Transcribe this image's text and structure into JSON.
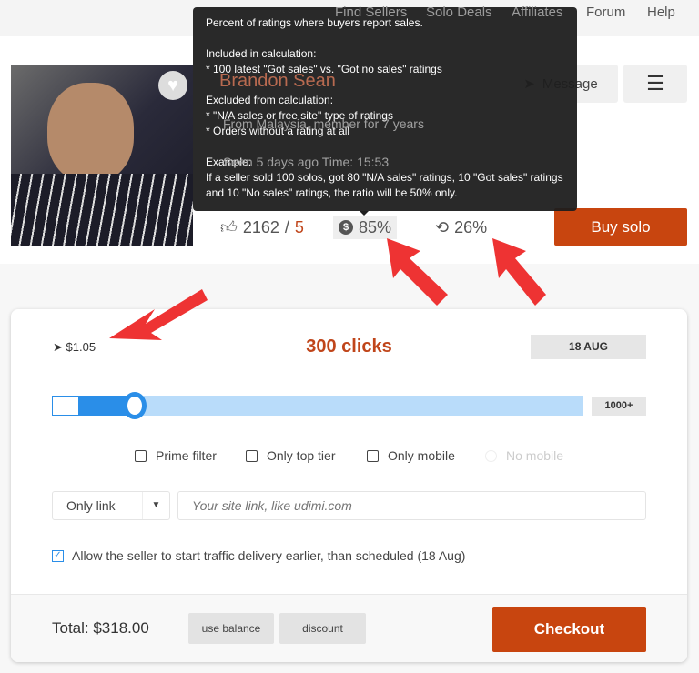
{
  "nav": {
    "items": [
      "Find Sellers",
      "Solo Deals",
      "Affiliates",
      "Forum",
      "Help"
    ]
  },
  "profile": {
    "name": "Brandon Sean",
    "location": "From Malaysia, member for 7 years",
    "seen": "Seen 5 days ago   Time: 15:53",
    "message_label": "Message",
    "menu_icon": "hamburger-icon",
    "favorite_icon": "heart-icon"
  },
  "stats": {
    "likes": "2162",
    "separator": "/",
    "dislikes": "5",
    "sales_ratio": "85%",
    "repeat": "26%",
    "buy_label": "Buy solo"
  },
  "tooltip": {
    "text": "Percent of ratings where buyers report sales.\n\nIncluded in calculation:\n* 100 latest \"Got sales\" vs. \"Got no sales\" ratings\n\nExcluded from calculation:\n* \"N/A sales or free site\" type of ratings\n* Orders without a rating at all\n\nExample:\nIf a seller sold 100 solos, got 80 \"N/A sales\" ratings, 10 \"Got sales\" ratings and 10 \"No sales\" ratings, the ratio will be 50% only."
  },
  "order": {
    "price": "$1.05",
    "clicks": "300 clicks",
    "date": "18 AUG",
    "slider_max": "1000+",
    "slider_value": 300,
    "filters": [
      {
        "label": "Prime filter",
        "checked": false
      },
      {
        "label": "Only top tier",
        "checked": false
      },
      {
        "label": "Only mobile",
        "checked": false
      },
      {
        "label": "No mobile",
        "disabled": true
      }
    ],
    "link_type": "Only link",
    "link_placeholder": "Your site link, like udimi.com",
    "allow_early": "Allow the seller to start traffic delivery earlier, than scheduled (18 Aug)",
    "allow_checked": true
  },
  "footer": {
    "total": "Total: $318.00",
    "use_balance": "use balance",
    "discount": "discount",
    "checkout": "Checkout"
  },
  "colors": {
    "accent": "#c8450f",
    "slider": "#2a8ee8",
    "annotation": "#ee3333"
  }
}
